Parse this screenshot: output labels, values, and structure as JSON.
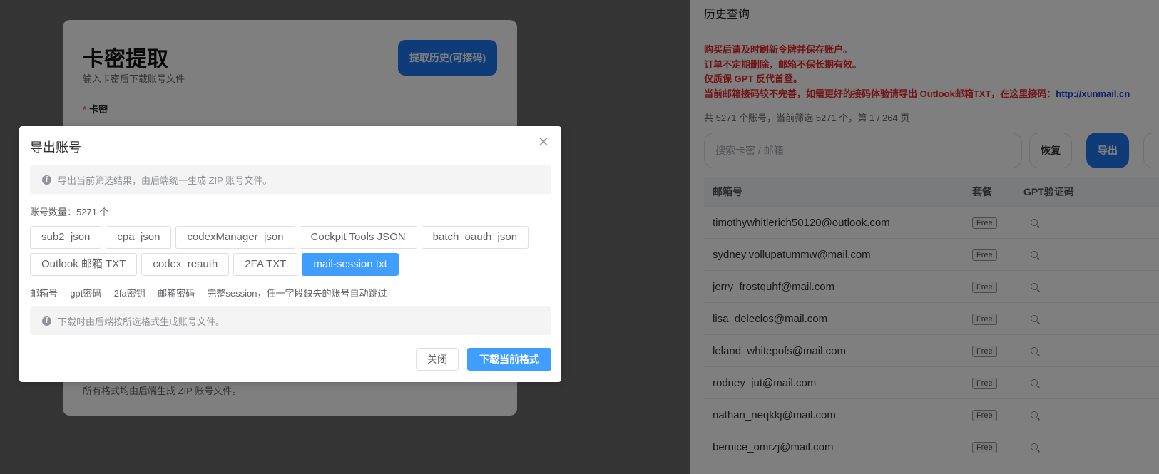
{
  "left_card": {
    "title": "卡密提取",
    "subtitle": "输入卡密后下载账号文件",
    "history_button": "提取历史(可接码)",
    "field_required_mark": "*",
    "field_label": "卡密",
    "footer_note": "所有格式均由后端生成 ZIP 账号文件。"
  },
  "history": {
    "title": "历史查询",
    "notices": [
      "购买后请及时刷新令牌并保存账户。",
      "订单不定期删除，邮箱不保长期有效。",
      "仅质保 GPT 反代首登。",
      "当前邮箱接码较不完善，如需更好的接码体验请导出 Outlook邮箱TXT，在这里接码："
    ],
    "notice_link": "http://xunmail.cn",
    "summary": "共 5271 个账号，当前筛选 5271 个，第 1 / 264 页",
    "search_placeholder": "搜索卡密 / 邮箱",
    "reset_button": "恢复",
    "export_button": "导出",
    "columns": {
      "email": "邮箱号",
      "plan": "套餐",
      "code": "GPT验证码"
    },
    "rows": [
      {
        "email": "timothywhitlerich50120@outlook.com",
        "plan": "Free"
      },
      {
        "email": "sydney.vollupatummw@mail.com",
        "plan": "Free"
      },
      {
        "email": "jerry_frostquhf@mail.com",
        "plan": "Free"
      },
      {
        "email": "lisa_deleclos@mail.com",
        "plan": "Free"
      },
      {
        "email": "leland_whitepofs@mail.com",
        "plan": "Free"
      },
      {
        "email": "rodney_jut@mail.com",
        "plan": "Free"
      },
      {
        "email": "nathan_neqkkj@mail.com",
        "plan": "Free"
      },
      {
        "email": "bernice_omrzj@mail.com",
        "plan": "Free"
      }
    ]
  },
  "modal": {
    "title": "导出账号",
    "close_symbol": "×",
    "info_symbol": "i",
    "info_top": "导出当前筛选结果，由后端统一生成 ZIP 账号文件。",
    "count_label": "账号数量：5271 个",
    "formats": [
      "sub2_json",
      "cpa_json",
      "codexManager_json",
      "Cockpit Tools JSON",
      "batch_oauth_json",
      "Outlook 邮箱 TXT",
      "codex_reauth",
      "2FA TXT",
      "mail-session txt"
    ],
    "selected_format": "mail-session txt",
    "format_hint": "邮箱号----gpt密码----2fa密钥----邮箱密码----完整session，任一字段缺失的账号自动跳过",
    "info_bottom": "下载时由后端按所选格式生成账号文件。",
    "close_button": "关闭",
    "download_button": "下载当前格式"
  },
  "colors": {
    "primary": "#409eff",
    "accent_blue": "#1e79f0",
    "notice_red": "#e4262b",
    "link_blue": "#1d3bd8"
  }
}
